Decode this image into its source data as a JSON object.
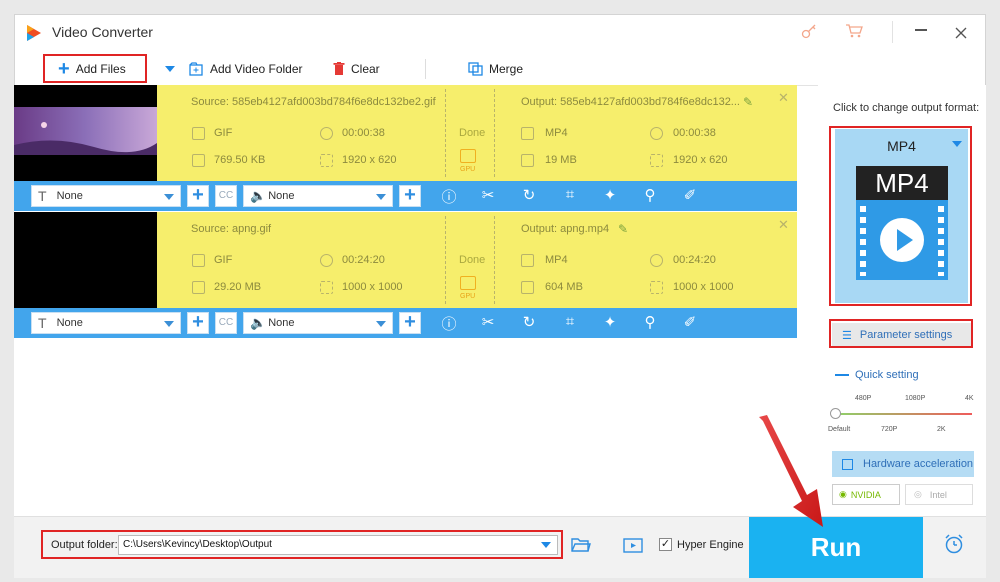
{
  "app": {
    "title": "Video Converter"
  },
  "toolbar": {
    "add_files": "Add Files",
    "add_folder": "Add Video Folder",
    "clear": "Clear",
    "merge": "Merge"
  },
  "items": [
    {
      "source": "Source: 585eb4127afd003bd784f6e8dc132be2.gif",
      "src_format": "GIF",
      "src_duration": "00:00:38",
      "src_size": "769.50 KB",
      "src_res": "1920 x 620",
      "status": "Done",
      "gpu": "GPU",
      "output": "Output: 585eb4127afd003bd784f6e8dc132...",
      "out_format": "MP4",
      "out_duration": "00:00:38",
      "out_size": "19 MB",
      "out_res": "1920 x 620",
      "subtitle": "None",
      "audio": "None"
    },
    {
      "source": "Source: apng.gif",
      "src_format": "GIF",
      "src_duration": "00:24:20",
      "src_size": "29.20 MB",
      "src_res": "1000 x 1000",
      "status": "Done",
      "gpu": "GPU",
      "output": "Output: apng.mp4",
      "out_format": "MP4",
      "out_duration": "00:24:20",
      "out_size": "604 MB",
      "out_res": "1000 x 1000",
      "subtitle": "None",
      "audio": "None"
    }
  ],
  "sidebar": {
    "hint": "Click to change output format:",
    "format": "MP4",
    "format_icon_text": "MP4",
    "param_settings": "Parameter settings",
    "quick_setting": "Quick setting",
    "quality_top": [
      "480P",
      "1080P",
      "4K"
    ],
    "quality_bottom": [
      "Default",
      "720P",
      "2K"
    ],
    "quality_level": 0,
    "hw_accel": "Hardware acceleration",
    "nvidia": "NVIDIA",
    "intel": "Intel"
  },
  "bottom": {
    "output_label": "Output folder:",
    "output_path": "C:\\Users\\Kevincy\\Desktop\\Output",
    "hyper_engine": "Hyper Engine",
    "hyper_checked": true,
    "run": "Run"
  },
  "colors": {
    "accent": "#1ab2f1",
    "row_bg": "#f6ee6c",
    "ctrl_bg": "#42a5ec",
    "annotation": "#e02424"
  }
}
